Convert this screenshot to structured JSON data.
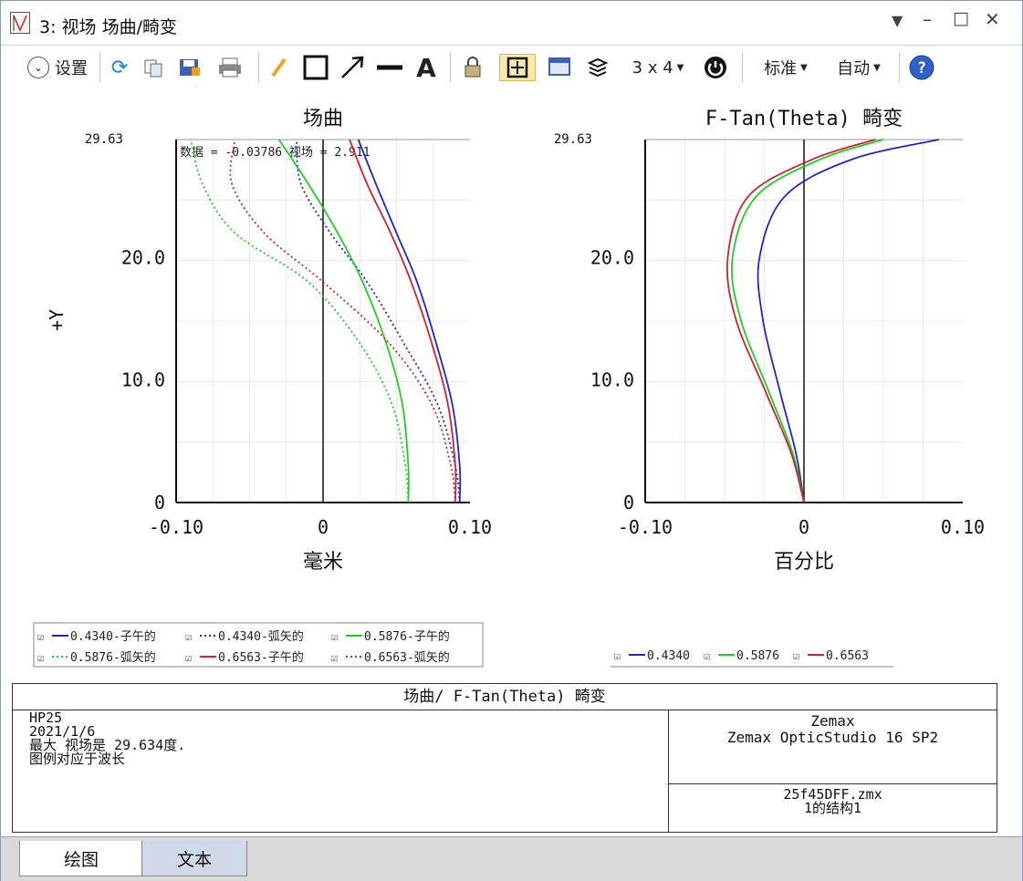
{
  "window": {
    "title": "3: 视场 场曲/畸变"
  },
  "toolbar": {
    "settings_label": "设置",
    "grid_label": "3 x 4",
    "standard_label": "标准",
    "auto_label": "自动"
  },
  "colors": {
    "blue": "#2424c8",
    "green": "#22cc22",
    "red": "#cc2233"
  },
  "chart_data": [
    {
      "type": "line",
      "title": "场曲",
      "xlabel": "毫米",
      "ylabel": "+Y",
      "xlim": [
        -0.1,
        0.1
      ],
      "ylim": [
        0,
        29.63
      ],
      "xticks": [
        "-0.10",
        "0",
        "0.10"
      ],
      "yticks": [
        "0",
        "10.0",
        "20.0"
      ],
      "ymax_label": "29.63",
      "annotation": "数据 = -0.03786 视场 = 2.911",
      "legend": [
        "0.4340-子午的",
        "0.4340-弧矢的",
        "0.5876-子午的",
        "0.5876-弧矢的",
        "0.6563-子午的",
        "0.6563-弧矢的"
      ],
      "series": [
        {
          "name": "0.4340-子午的",
          "color": "blue",
          "dash": false,
          "points": [
            [
              0.093,
              0
            ],
            [
              0.093,
              3
            ],
            [
              0.088,
              8
            ],
            [
              0.077,
              13
            ],
            [
              0.064,
              18
            ],
            [
              0.05,
              22
            ],
            [
              0.036,
              26
            ],
            [
              0.024,
              29.63
            ]
          ]
        },
        {
          "name": "0.4340-弧矢的",
          "color": "blue",
          "dash": true,
          "points": [
            [
              0.093,
              0
            ],
            [
              0.09,
              3
            ],
            [
              0.078,
              8
            ],
            [
              0.055,
              13
            ],
            [
              0.03,
              18
            ],
            [
              0.005,
              22
            ],
            [
              -0.015,
              26
            ],
            [
              -0.018,
              29.63
            ]
          ]
        },
        {
          "name": "0.5876-子午的",
          "color": "green",
          "dash": false,
          "points": [
            [
              0.058,
              0
            ],
            [
              0.058,
              3
            ],
            [
              0.054,
              8
            ],
            [
              0.043,
              13
            ],
            [
              0.027,
              18
            ],
            [
              0.01,
              22
            ],
            [
              -0.01,
              26
            ],
            [
              -0.03,
              29.63
            ]
          ]
        },
        {
          "name": "0.5876-弧矢的",
          "color": "green",
          "dash": true,
          "points": [
            [
              0.058,
              0
            ],
            [
              0.056,
              3
            ],
            [
              0.047,
              8
            ],
            [
              0.025,
              13
            ],
            [
              -0.01,
              18
            ],
            [
              -0.06,
              22
            ],
            [
              -0.082,
              26
            ],
            [
              -0.09,
              29.63
            ]
          ]
        },
        {
          "name": "0.6563-子午的",
          "color": "red",
          "dash": false,
          "points": [
            [
              0.09,
              0
            ],
            [
              0.09,
              3
            ],
            [
              0.085,
              8
            ],
            [
              0.074,
              13
            ],
            [
              0.06,
              18
            ],
            [
              0.046,
              22
            ],
            [
              0.03,
              26
            ],
            [
              0.018,
              29.63
            ]
          ]
        },
        {
          "name": "0.6563-弧矢的",
          "color": "red",
          "dash": true,
          "points": [
            [
              0.09,
              0
            ],
            [
              0.087,
              3
            ],
            [
              0.074,
              8
            ],
            [
              0.045,
              13
            ],
            [
              0.0,
              18
            ],
            [
              -0.04,
              22
            ],
            [
              -0.062,
              26
            ],
            [
              -0.06,
              29.63
            ]
          ]
        }
      ]
    },
    {
      "type": "line",
      "title": "F-Tan(Theta) 畸变",
      "xlabel": "百分比",
      "xlim": [
        -0.1,
        0.1
      ],
      "ylim": [
        0,
        29.63
      ],
      "xticks": [
        "-0.10",
        "0",
        "0.10"
      ],
      "yticks": [
        "0",
        "10.0",
        "20.0"
      ],
      "ymax_label": "29.63",
      "legend": [
        "0.4340",
        "0.5876",
        "0.6563"
      ],
      "series": [
        {
          "name": "0.4340",
          "color": "blue",
          "dash": false,
          "points": [
            [
              0,
              0
            ],
            [
              -0.005,
              4
            ],
            [
              -0.015,
              9
            ],
            [
              -0.026,
              15
            ],
            [
              -0.028,
              20
            ],
            [
              -0.012,
              25
            ],
            [
              0.03,
              28
            ],
            [
              0.085,
              29.63
            ]
          ]
        },
        {
          "name": "0.5876",
          "color": "green",
          "dash": false,
          "points": [
            [
              0,
              0
            ],
            [
              -0.007,
              4
            ],
            [
              -0.022,
              9
            ],
            [
              -0.04,
              15
            ],
            [
              -0.045,
              20
            ],
            [
              -0.03,
              25
            ],
            [
              0.01,
              28
            ],
            [
              0.05,
              29.63
            ]
          ]
        },
        {
          "name": "0.6563",
          "color": "red",
          "dash": false,
          "points": [
            [
              0,
              0
            ],
            [
              -0.008,
              4
            ],
            [
              -0.024,
              9
            ],
            [
              -0.043,
              15
            ],
            [
              -0.048,
              20
            ],
            [
              -0.035,
              25
            ],
            [
              0.005,
              28
            ],
            [
              0.045,
              29.63
            ]
          ]
        }
      ]
    }
  ],
  "info": {
    "title": "场曲/ F-Tan(Theta) 畸变",
    "lines": [
      "HP25",
      "2021/1/6",
      "最大 视场是 29.634度.",
      "图例对应于波长"
    ],
    "company": "Zemax",
    "product": "Zemax OpticStudio 16 SP2",
    "file": "25f45DFF.zmx",
    "config": "1的结构1"
  },
  "tabs": [
    {
      "label": "绘图"
    },
    {
      "label": "文本"
    }
  ]
}
